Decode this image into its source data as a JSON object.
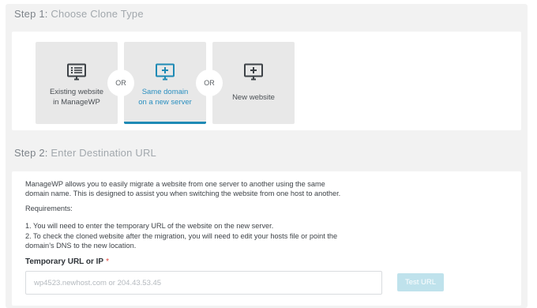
{
  "step1": {
    "number": "Step 1:",
    "title": "Choose Clone Type"
  },
  "options": [
    {
      "label_line1": "Existing website",
      "label_line2": "in ManageWP",
      "icon": "list-monitor-icon",
      "selected": false
    },
    {
      "label_line1": "Same domain",
      "label_line2": "on a new server",
      "icon": "plus-monitor-icon",
      "selected": true
    },
    {
      "label_line1": "New website",
      "label_line2": "",
      "icon": "plus-monitor-icon",
      "selected": false
    }
  ],
  "or_label": "OR",
  "step2": {
    "number": "Step 2:",
    "title": "Enter Destination URL"
  },
  "description": {
    "line1": "ManageWP allows you to easily migrate a website from one server to another using the same",
    "line2": "domain name. This is designed to assist you when switching the website from one host to another."
  },
  "requirements": {
    "heading": "Requirements:",
    "item1": "1. You will need to enter the temporary URL of the website on the new server.",
    "item2_line1": "2. To check the cloned website after the migration, you will need to edit your hosts file or point the",
    "item2_line2": "domain’s DNS to the new location."
  },
  "field": {
    "label": "Temporary URL or IP",
    "required_mark": "*",
    "placeholder": "wp4523.newhost.com or 204.43.53.45",
    "value": ""
  },
  "test_button": "Test URL",
  "colors": {
    "accent": "#1f8ab5",
    "button_disabled": "#bfe2ec",
    "required": "#e0453a"
  }
}
